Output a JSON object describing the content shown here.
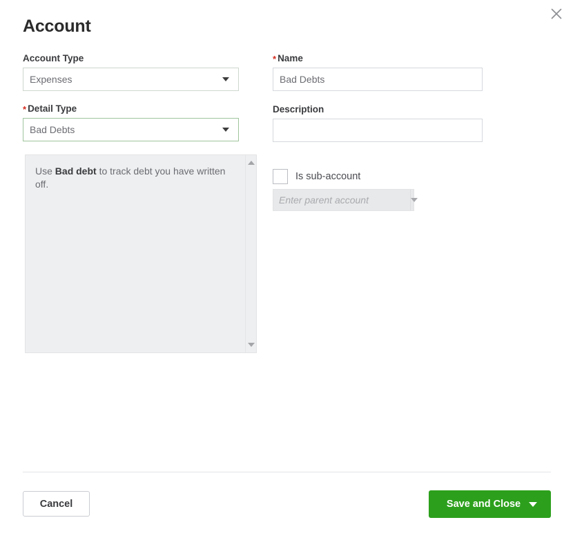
{
  "dialog": {
    "title": "Account",
    "close_icon": "close-icon"
  },
  "form": {
    "account_type": {
      "label": "Account Type",
      "required": false,
      "value": "Expenses",
      "caret_icon": "chevron-down-icon"
    },
    "detail_type": {
      "label": "Detail Type",
      "required": true,
      "required_marker": "*",
      "value": "Bad Debts",
      "caret_icon": "chevron-down-icon"
    },
    "name": {
      "label": "Name",
      "required": true,
      "required_marker": "*",
      "value": "Bad Debts",
      "placeholder": ""
    },
    "description": {
      "label": "Description",
      "required": false,
      "value": "",
      "placeholder": ""
    },
    "is_sub_account": {
      "label": "Is sub-account",
      "checked": false
    },
    "parent_account": {
      "value": "",
      "placeholder": "Enter parent account",
      "disabled": true,
      "caret_icon": "chevron-down-icon"
    }
  },
  "help": {
    "text_prefix": "Use ",
    "text_bold": "Bad debt",
    "text_suffix": " to track debt you have written off.",
    "scroll_up_icon": "triangle-up-icon",
    "scroll_down_icon": "triangle-down-icon"
  },
  "footer": {
    "cancel_label": "Cancel",
    "save_label": "Save and Close",
    "save_caret_icon": "chevron-down-icon"
  },
  "colors": {
    "brand_green": "#2ca01c",
    "required_red": "#d52b1e",
    "focus_border": "#9ec49c",
    "text_dark": "#393a3d",
    "text_muted": "#6b6c72",
    "panel_bg": "#eeeff0"
  }
}
